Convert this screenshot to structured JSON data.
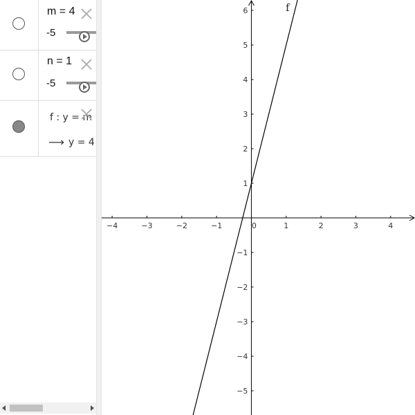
{
  "algebra": {
    "rows": [
      {
        "definition": "m = 4",
        "slider_min": "-5",
        "visible": false
      },
      {
        "definition": "n = 1",
        "slider_min": "-5",
        "visible": false
      },
      {
        "definition": "f : y = m",
        "output_arrow": "⟶",
        "output": "y = 4",
        "visible": true
      }
    ]
  },
  "graphics": {
    "x_ticks": [
      "−4",
      "−3",
      "−2",
      "−1",
      "0",
      "1",
      "2",
      "3",
      "4"
    ],
    "x_tick_values": [
      -4,
      -3,
      -2,
      -1,
      0,
      1,
      2,
      3,
      4
    ],
    "y_ticks": [
      "−5",
      "−4",
      "−3",
      "−2",
      "−1",
      "1",
      "2",
      "3",
      "4",
      "5",
      "6"
    ],
    "y_tick_values": [
      -5,
      -4,
      -3,
      -2,
      -1,
      1,
      2,
      3,
      4,
      5,
      6
    ],
    "function_label": "f",
    "slope": 4,
    "intercept": 1,
    "x_range": [
      -4.3,
      4.7
    ],
    "y_range": [
      -5.7,
      6.3
    ],
    "axis_color": "#000000",
    "line_color": "#000000"
  }
}
